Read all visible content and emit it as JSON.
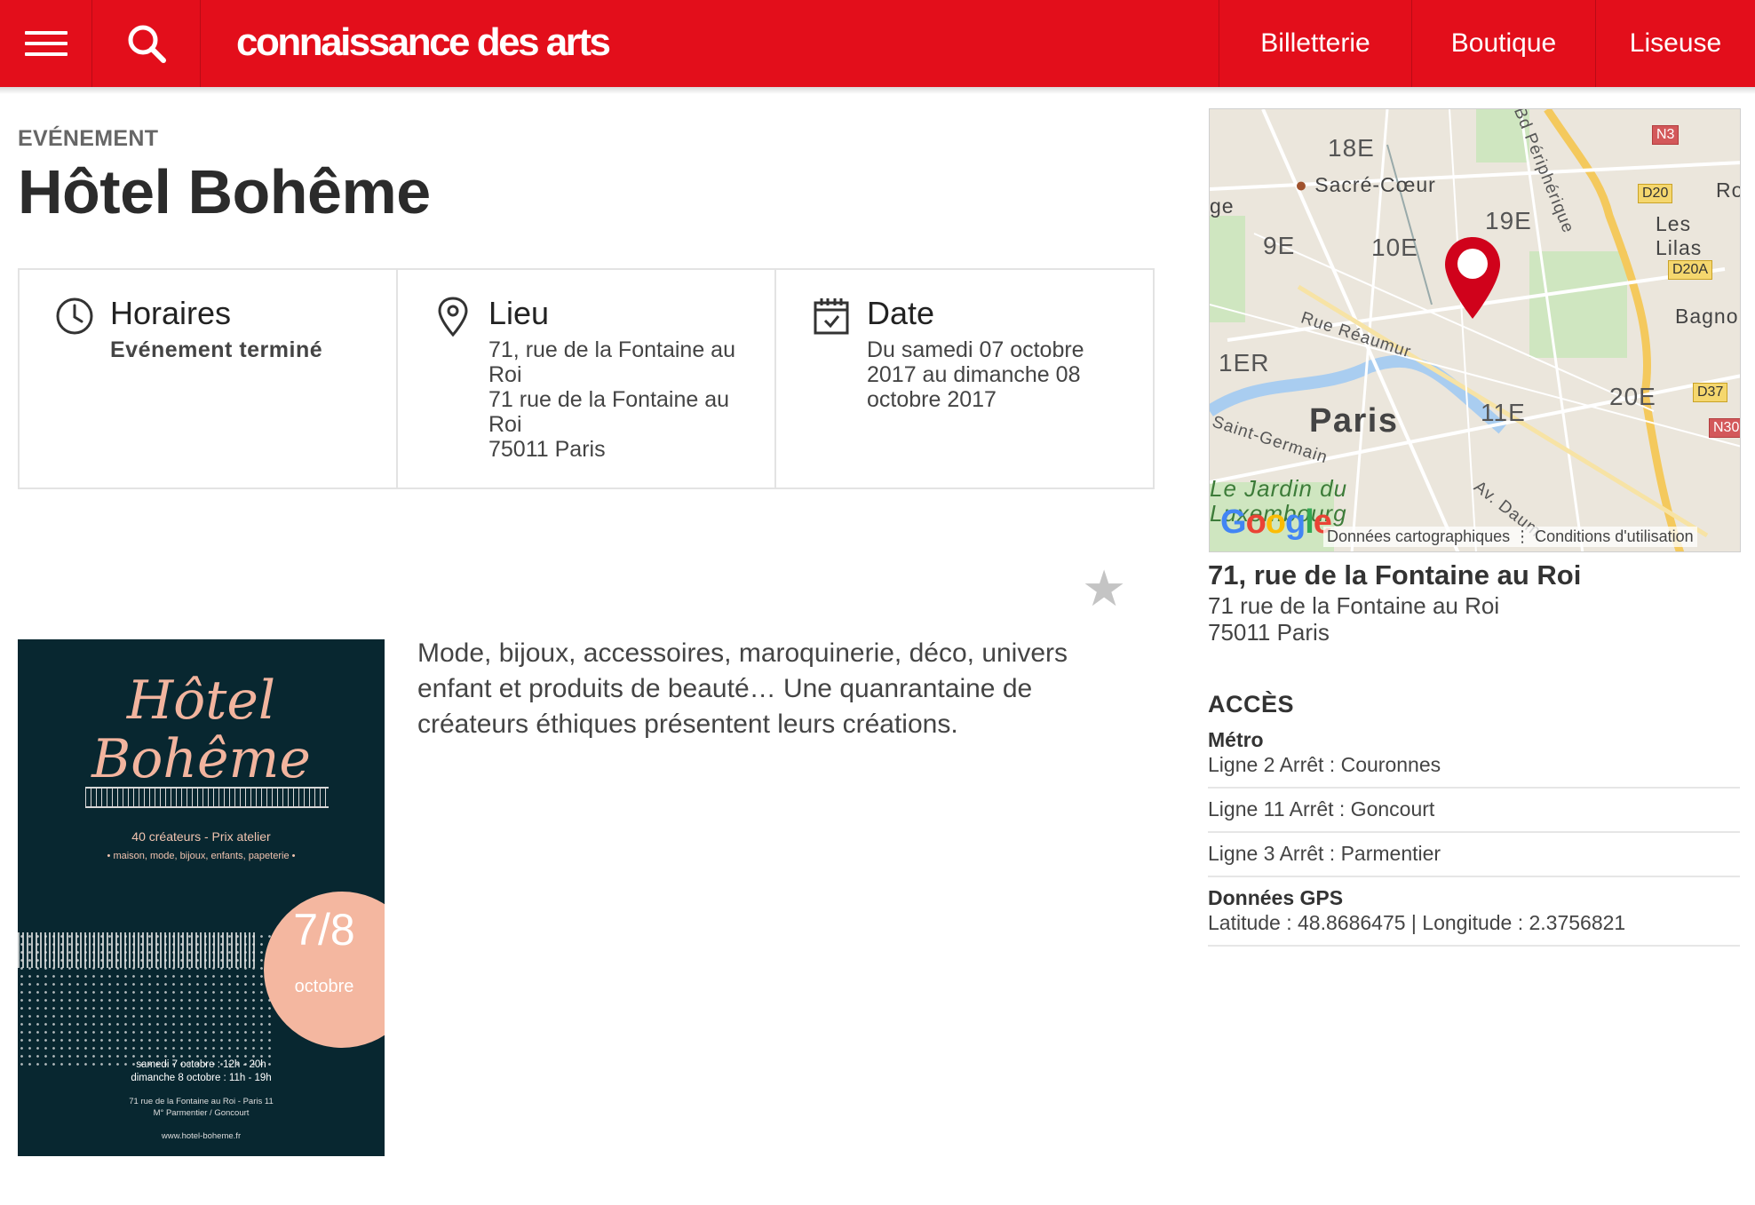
{
  "header": {
    "logo": "connaissance des arts",
    "nav": [
      "Billetterie",
      "Boutique",
      "Liseuse"
    ],
    "accent_color": "#e30e1b",
    "icons": [
      "menu-icon",
      "search-icon"
    ]
  },
  "event": {
    "kicker": "EVÉNEMENT",
    "title": "Hôtel Bohême"
  },
  "info": {
    "horaires_title": "Horaires",
    "horaires_status": "Evénement terminé",
    "lieu_title": "Lieu",
    "lieu_line1": "71, rue de la Fontaine au Roi",
    "lieu_line2": "71 rue de la Fontaine au Roi",
    "lieu_line3": "75011 Paris",
    "date_title": "Date",
    "date_text": "Du samedi 07 octobre 2017 au dimanche 08 octobre 2017"
  },
  "poster": {
    "title_line1": "Hôtel",
    "title_line2": "Bohême",
    "line1": "40 créateurs - Prix atelier",
    "line2": "• maison, mode, bijoux, enfants, papeterie •",
    "date": "7/8",
    "month": "octobre",
    "schedule1": "samedi 7 octobre : 12h - 20h",
    "schedule2": "dimanche 8 octobre : 11h - 19h",
    "address1": "71 rue de la Fontaine au Roi - Paris 11",
    "address2": "M° Parmentier / Goncourt",
    "url": "www.hotel-boheme.fr"
  },
  "description": "Mode, bijoux, accessoires, maroquinerie, déco, univers enfant et produits de beauté… Une quanrantaine de créateurs éthiques présentent leurs créations.",
  "map": {
    "labels": {
      "a18": "18E",
      "sacre": "Sacré-Cœur",
      "ge": "ge",
      "a9": "9E",
      "a10": "10E",
      "a19": "19E",
      "lilas": "Les Lilas",
      "bagno": "Bagno",
      "reaumur": "Rue Réaumur",
      "a1": "1ER",
      "paris": "Paris",
      "a11": "11E",
      "a20": "20E",
      "stgermain": "Saint-Germain",
      "jardin1": "Le Jardin du",
      "jardin2": "Luxembourg",
      "peripherique": "Bd Périphérique",
      "daum": "Av. Daum",
      "ro": "Ro"
    },
    "shields": {
      "n3": "N3",
      "d20": "D20",
      "d20a": "D20A",
      "d37": "D37",
      "n30": "N30"
    },
    "google": "Google",
    "attribution": "Données cartographiques ⋮ Conditions d'utilisation",
    "pin_color": "#d0021b"
  },
  "address": {
    "title": "71, rue de la Fontaine au Roi",
    "line1": "71 rue de la Fontaine au Roi",
    "line2": "75011 Paris"
  },
  "acces": {
    "title": "ACCÈS",
    "metro_label": "Métro",
    "lines": [
      "Ligne 2 Arrêt : Couronnes",
      "Ligne 11 Arrêt : Goncourt",
      "Ligne 3 Arrêt : Parmentier"
    ],
    "gps_label": "Données GPS",
    "gps": "Latitude : 48.8686475 | Longitude : 2.3756821"
  }
}
